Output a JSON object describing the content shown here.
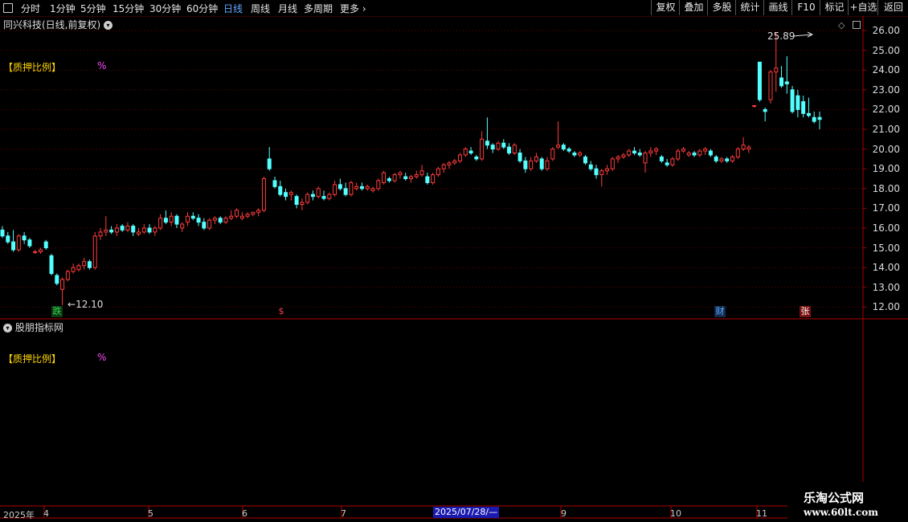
{
  "toolbar": {
    "periods": [
      "分时",
      "1分钟",
      "5分钟",
      "15分钟",
      "30分钟",
      "60分钟",
      "日线",
      "周线",
      "月线",
      "多周期",
      "更多"
    ],
    "active_period": "日线",
    "right_buttons": [
      "复权",
      "叠加",
      "多股",
      "统计",
      "画线",
      "F10",
      "标记",
      "+自选",
      "返回"
    ]
  },
  "chart_title": "同兴科技(日线,前复权)",
  "indicator_label": "【质押比例】",
  "indicator_unit": "%",
  "lower_panel_title": "股朋指标网",
  "price_axis": [
    "26.00",
    "25.00",
    "24.00",
    "23.00",
    "22.00",
    "21.00",
    "20.00",
    "19.00",
    "18.00",
    "17.00",
    "16.00",
    "15.00",
    "14.00",
    "13.00",
    "12.00"
  ],
  "annotations": {
    "high": "25.89",
    "low": "12.10"
  },
  "events": [
    {
      "label": "跌",
      "color": "#39d353",
      "bg": "#0b3d12"
    },
    {
      "label": "$",
      "color": "#ff4040",
      "bg": "transparent"
    },
    {
      "label": "财",
      "color": "#5fa8ff",
      "bg": "#102a4a"
    },
    {
      "label": "张",
      "color": "#ffffff",
      "bg": "#7a1010"
    }
  ],
  "date_axis": {
    "year": "2025年",
    "months": [
      "4",
      "5",
      "6",
      "7",
      "9",
      "10",
      "11"
    ],
    "cursor_date": "2025/07/28/—"
  },
  "watermark": {
    "title": "乐淘公式网",
    "url": "www.60lt.com"
  },
  "colors": {
    "up": "#ff3c3c",
    "down": "#54ffff",
    "grid": "#6a0000",
    "axis": "#b00000"
  },
  "chart_data": {
    "type": "candlestick",
    "title": "同兴科技(日线,前复权)",
    "ylim": [
      11.5,
      26.3
    ],
    "candles": [
      [
        15.9,
        16.1,
        15.5,
        15.6
      ],
      [
        15.6,
        15.8,
        15.2,
        15.3
      ],
      [
        15.3,
        15.9,
        14.8,
        14.9
      ],
      [
        14.9,
        15.7,
        14.8,
        15.6
      ],
      [
        15.6,
        15.8,
        15.2,
        15.4
      ],
      [
        15.4,
        15.5,
        15.0,
        15.1
      ],
      [
        14.8,
        14.9,
        14.7,
        14.8
      ],
      [
        14.8,
        15.0,
        14.7,
        14.9
      ],
      [
        15.3,
        15.4,
        14.9,
        15.0
      ],
      [
        14.6,
        14.7,
        13.6,
        13.7
      ],
      [
        13.6,
        13.7,
        13.1,
        13.2
      ],
      [
        12.9,
        13.5,
        12.1,
        13.4
      ],
      [
        13.4,
        13.9,
        13.3,
        13.8
      ],
      [
        13.8,
        14.2,
        13.7,
        14.0
      ],
      [
        13.9,
        14.2,
        13.8,
        14.1
      ],
      [
        14.1,
        14.5,
        13.9,
        14.3
      ],
      [
        14.3,
        14.4,
        13.9,
        14.0
      ],
      [
        14.0,
        15.8,
        13.9,
        15.6
      ],
      [
        15.6,
        16.0,
        15.4,
        15.8
      ],
      [
        15.8,
        16.6,
        15.6,
        15.9
      ],
      [
        15.9,
        16.1,
        15.7,
        15.8
      ],
      [
        15.8,
        16.2,
        15.6,
        16.0
      ],
      [
        16.1,
        16.2,
        15.8,
        15.9
      ],
      [
        15.9,
        16.3,
        15.8,
        16.1
      ],
      [
        16.1,
        16.2,
        15.6,
        15.8
      ],
      [
        15.7,
        16.0,
        15.6,
        15.8
      ],
      [
        15.8,
        16.2,
        15.7,
        16.0
      ],
      [
        16.0,
        16.2,
        15.7,
        15.8
      ],
      [
        15.8,
        16.1,
        15.6,
        16.0
      ],
      [
        16.0,
        16.7,
        15.9,
        16.5
      ],
      [
        16.5,
        16.9,
        16.2,
        16.3
      ],
      [
        16.3,
        16.8,
        16.1,
        16.6
      ],
      [
        16.6,
        16.7,
        16.0,
        16.2
      ],
      [
        16.0,
        16.3,
        15.8,
        16.2
      ],
      [
        16.3,
        16.8,
        16.1,
        16.6
      ],
      [
        16.6,
        16.8,
        16.4,
        16.5
      ],
      [
        16.5,
        16.7,
        16.1,
        16.3
      ],
      [
        16.3,
        16.5,
        15.9,
        16.0
      ],
      [
        16.0,
        16.5,
        15.9,
        16.4
      ],
      [
        16.4,
        16.6,
        16.2,
        16.5
      ],
      [
        16.5,
        16.6,
        16.2,
        16.3
      ],
      [
        16.3,
        16.6,
        16.2,
        16.5
      ],
      [
        16.5,
        16.9,
        16.4,
        16.6
      ],
      [
        16.6,
        17.0,
        16.5,
        16.9
      ],
      [
        16.5,
        16.8,
        16.4,
        16.6
      ],
      [
        16.6,
        16.8,
        16.5,
        16.7
      ],
      [
        16.7,
        16.8,
        16.6,
        16.8
      ],
      [
        16.8,
        17.0,
        16.6,
        16.9
      ],
      [
        16.9,
        18.6,
        16.8,
        18.5
      ],
      [
        19.5,
        20.1,
        18.9,
        19.0
      ],
      [
        18.4,
        18.6,
        18.0,
        18.1
      ],
      [
        18.1,
        18.4,
        17.6,
        17.7
      ],
      [
        17.8,
        18.0,
        17.4,
        17.6
      ],
      [
        17.7,
        17.9,
        17.4,
        17.8
      ],
      [
        17.6,
        17.7,
        17.0,
        17.2
      ],
      [
        17.2,
        17.5,
        16.9,
        17.3
      ],
      [
        17.3,
        17.8,
        17.2,
        17.7
      ],
      [
        17.7,
        17.9,
        17.4,
        17.6
      ],
      [
        17.6,
        18.1,
        17.5,
        18.0
      ],
      [
        17.6,
        17.9,
        17.4,
        17.5
      ],
      [
        17.5,
        17.8,
        17.4,
        17.7
      ],
      [
        17.7,
        18.4,
        17.6,
        18.2
      ],
      [
        18.2,
        18.5,
        17.9,
        18.0
      ],
      [
        18.0,
        18.3,
        17.6,
        17.7
      ],
      [
        17.7,
        18.4,
        17.6,
        18.3
      ],
      [
        18.0,
        18.3,
        17.9,
        18.1
      ],
      [
        18.1,
        18.3,
        17.9,
        18.0
      ],
      [
        18.0,
        18.2,
        17.9,
        18.1
      ],
      [
        17.9,
        18.1,
        17.8,
        18.0
      ],
      [
        18.0,
        18.5,
        17.9,
        18.4
      ],
      [
        18.3,
        18.9,
        18.2,
        18.8
      ],
      [
        18.5,
        18.6,
        18.3,
        18.4
      ],
      [
        18.4,
        18.8,
        18.3,
        18.7
      ],
      [
        18.7,
        18.9,
        18.5,
        18.8
      ],
      [
        18.6,
        18.8,
        18.4,
        18.5
      ],
      [
        18.5,
        18.7,
        18.3,
        18.6
      ],
      [
        18.6,
        18.9,
        18.5,
        18.7
      ],
      [
        18.7,
        19.2,
        18.6,
        18.9
      ],
      [
        18.6,
        18.8,
        18.2,
        18.3
      ],
      [
        18.3,
        18.8,
        18.2,
        18.7
      ],
      [
        18.7,
        19.1,
        18.6,
        19.0
      ],
      [
        19.0,
        19.3,
        18.8,
        19.2
      ],
      [
        19.2,
        19.4,
        19.0,
        19.3
      ],
      [
        19.3,
        19.5,
        19.2,
        19.4
      ],
      [
        19.4,
        19.8,
        19.3,
        19.7
      ],
      [
        19.7,
        20.1,
        19.6,
        20.0
      ],
      [
        19.9,
        20.1,
        19.7,
        19.8
      ],
      [
        19.6,
        19.7,
        19.4,
        19.5
      ],
      [
        19.5,
        20.9,
        19.4,
        20.5
      ],
      [
        20.4,
        21.6,
        20.0,
        20.2
      ],
      [
        20.2,
        20.3,
        19.8,
        20.0
      ],
      [
        20.0,
        20.4,
        19.9,
        20.3
      ],
      [
        20.3,
        20.5,
        20.0,
        20.1
      ],
      [
        20.1,
        20.3,
        19.7,
        19.8
      ],
      [
        19.8,
        20.3,
        19.7,
        20.2
      ],
      [
        19.8,
        20.0,
        19.3,
        19.4
      ],
      [
        19.4,
        19.6,
        18.8,
        19.0
      ],
      [
        19.0,
        19.6,
        18.9,
        19.4
      ],
      [
        19.4,
        19.8,
        19.3,
        19.6
      ],
      [
        19.5,
        19.6,
        18.9,
        19.0
      ],
      [
        19.0,
        19.6,
        18.9,
        19.4
      ],
      [
        19.5,
        20.1,
        19.4,
        20.0
      ],
      [
        20.1,
        21.4,
        20.0,
        20.2
      ],
      [
        20.2,
        20.3,
        19.9,
        20.0
      ],
      [
        20.0,
        20.1,
        19.8,
        19.9
      ],
      [
        19.8,
        19.9,
        19.6,
        19.7
      ],
      [
        19.7,
        19.9,
        19.6,
        19.8
      ],
      [
        19.6,
        19.7,
        19.2,
        19.3
      ],
      [
        19.2,
        19.4,
        18.9,
        19.0
      ],
      [
        19.0,
        19.2,
        18.5,
        18.7
      ],
      [
        18.7,
        19.0,
        18.1,
        18.9
      ],
      [
        18.9,
        19.2,
        18.7,
        19.0
      ],
      [
        19.0,
        19.6,
        18.9,
        19.5
      ],
      [
        19.5,
        19.7,
        19.3,
        19.6
      ],
      [
        19.6,
        19.8,
        19.5,
        19.7
      ],
      [
        19.7,
        20.0,
        19.6,
        19.9
      ],
      [
        19.9,
        20.1,
        19.7,
        19.8
      ],
      [
        19.8,
        20.0,
        19.6,
        19.7
      ],
      [
        19.3,
        19.9,
        18.8,
        19.8
      ],
      [
        19.8,
        20.1,
        19.6,
        19.9
      ],
      [
        19.9,
        20.1,
        19.7,
        20.0
      ],
      [
        19.6,
        19.7,
        19.3,
        19.4
      ],
      [
        19.3,
        19.5,
        19.1,
        19.2
      ],
      [
        19.2,
        19.6,
        19.1,
        19.5
      ],
      [
        19.5,
        20.0,
        19.4,
        19.9
      ],
      [
        19.9,
        20.1,
        19.8,
        20.0
      ],
      [
        19.7,
        19.9,
        19.6,
        19.8
      ],
      [
        19.8,
        19.9,
        19.6,
        19.7
      ],
      [
        19.7,
        20.0,
        19.6,
        19.9
      ],
      [
        19.9,
        20.1,
        19.7,
        20.0
      ],
      [
        19.9,
        20.0,
        19.6,
        19.7
      ],
      [
        19.6,
        19.7,
        19.3,
        19.4
      ],
      [
        19.4,
        19.6,
        19.3,
        19.5
      ],
      [
        19.5,
        19.6,
        19.3,
        19.4
      ],
      [
        19.4,
        19.7,
        19.3,
        19.6
      ],
      [
        19.6,
        20.1,
        19.5,
        20.0
      ],
      [
        20.0,
        20.6,
        19.9,
        20.2
      ],
      [
        20.0,
        20.2,
        19.8,
        20.1
      ],
      [
        22.2,
        22.2,
        22.1,
        22.2
      ],
      [
        24.4,
        24.4,
        22.4,
        22.5
      ],
      [
        22.0,
        22.1,
        21.4,
        21.9
      ],
      [
        22.5,
        24.0,
        22.3,
        23.9
      ],
      [
        23.9,
        25.89,
        22.9,
        24.1
      ],
      [
        23.6,
        24.2,
        23.1,
        23.2
      ],
      [
        23.4,
        24.7,
        22.8,
        23.3
      ],
      [
        23.0,
        23.2,
        21.8,
        21.9
      ],
      [
        22.7,
        23.0,
        21.6,
        22.0
      ],
      [
        22.4,
        22.7,
        21.6,
        21.8
      ],
      [
        21.8,
        22.6,
        21.6,
        21.7
      ],
      [
        21.6,
        21.9,
        21.3,
        21.4
      ],
      [
        21.6,
        21.9,
        21.0,
        21.5
      ]
    ]
  }
}
